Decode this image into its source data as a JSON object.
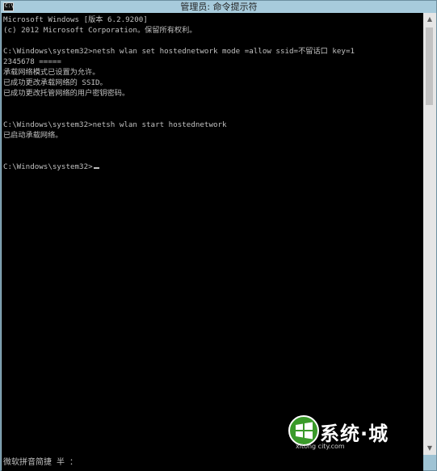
{
  "window": {
    "title": "管理员: 命令提示符",
    "icon_label": "C:\\"
  },
  "console": {
    "lines": [
      "Microsoft Windows [版本 6.2.9200]",
      "(c) 2012 Microsoft Corporation。保留所有权利。",
      "",
      "C:\\Windows\\system32>netsh wlan set hostednetwork mode =allow ssid=不留话口 key=1",
      "2345678 =====",
      "承载网络模式已设置为允许。",
      "已成功更改承载网络的 SSID。",
      "已成功更改托管网络的用户密钥密码。",
      "",
      "",
      "C:\\Windows\\system32>netsh wlan start hostednetwork",
      "已启动承载网络。",
      "",
      "",
      "C:\\Windows\\system32>"
    ],
    "text_color": "#c0c0c0",
    "background": "#000000"
  },
  "ime": {
    "status": "微软拼音简捷 半 ："
  },
  "watermark": {
    "brand": "系统·城",
    "url": "xitong city.com",
    "icon": "windows-logo-icon"
  },
  "scrollbar": {
    "up_icon": "arrow-up-icon",
    "down_icon": "arrow-down-icon"
  }
}
